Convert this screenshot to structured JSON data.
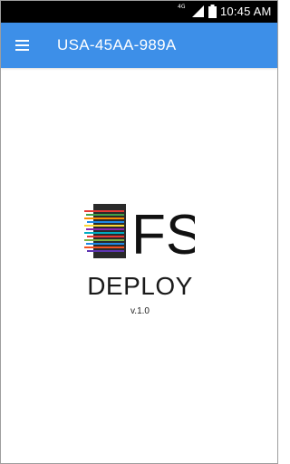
{
  "status_bar": {
    "network_label": "4G",
    "time": "10:45 AM",
    "icons": [
      "network-type-icon",
      "signal-icon",
      "battery-icon"
    ]
  },
  "app_bar": {
    "title": "USA-45AA-989A",
    "menu_icon": "hamburger-menu-icon",
    "color": "#3d8fe8"
  },
  "splash": {
    "logo_text": "FS",
    "product_name": "DEPLOY",
    "version": "v.1.0"
  }
}
